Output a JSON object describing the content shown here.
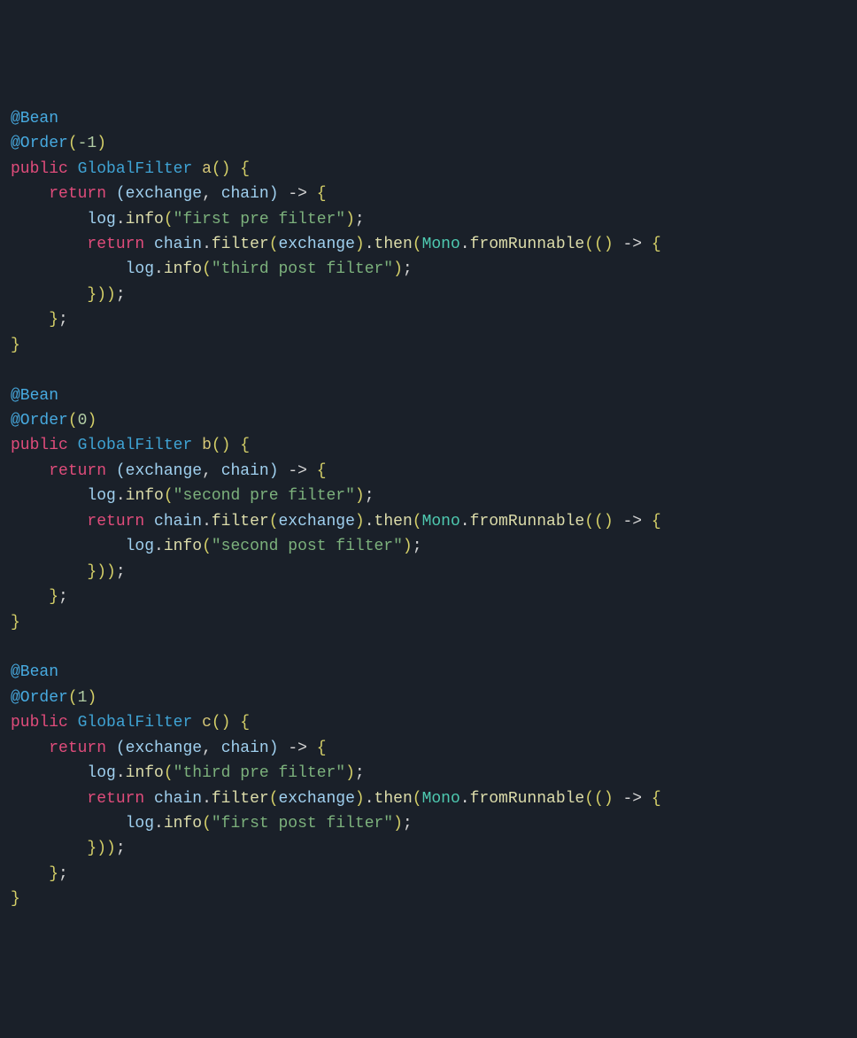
{
  "code": {
    "methods": [
      {
        "annotation_bean": "@Bean",
        "annotation_order_prefix": "@Order",
        "order_value": "-1",
        "visibility": "public",
        "return_type": "GlobalFilter",
        "method_name": "a",
        "outer_return": "return",
        "lambda_params": "(exchange, chain)",
        "arrow": "->",
        "log_obj": "log",
        "info_call": "info",
        "pre_string": "\"first pre filter\"",
        "inner_return": "return",
        "chain_ident": "chain",
        "filter_call": "filter",
        "exchange_arg": "exchange",
        "then_call": "then",
        "mono_class": "Mono",
        "fromRunnable_call": "fromRunnable",
        "post_string": "\"third post filter\""
      },
      {
        "annotation_bean": "@Bean",
        "annotation_order_prefix": "@Order",
        "order_value": "0",
        "visibility": "public",
        "return_type": "GlobalFilter",
        "method_name": "b",
        "outer_return": "return",
        "lambda_params": "(exchange, chain)",
        "arrow": "->",
        "log_obj": "log",
        "info_call": "info",
        "pre_string": "\"second pre filter\"",
        "inner_return": "return",
        "chain_ident": "chain",
        "filter_call": "filter",
        "exchange_arg": "exchange",
        "then_call": "then",
        "mono_class": "Mono",
        "fromRunnable_call": "fromRunnable",
        "post_string": "\"second post filter\""
      },
      {
        "annotation_bean": "@Bean",
        "annotation_order_prefix": "@Order",
        "order_value": "1",
        "visibility": "public",
        "return_type": "GlobalFilter",
        "method_name": "c",
        "outer_return": "return",
        "lambda_params": "(exchange, chain)",
        "arrow": "->",
        "log_obj": "log",
        "info_call": "info",
        "pre_string": "\"third pre filter\"",
        "inner_return": "return",
        "chain_ident": "chain",
        "filter_call": "filter",
        "exchange_arg": "exchange",
        "then_call": "then",
        "mono_class": "Mono",
        "fromRunnable_call": "fromRunnable",
        "post_string": "\"first post filter\""
      }
    ]
  }
}
